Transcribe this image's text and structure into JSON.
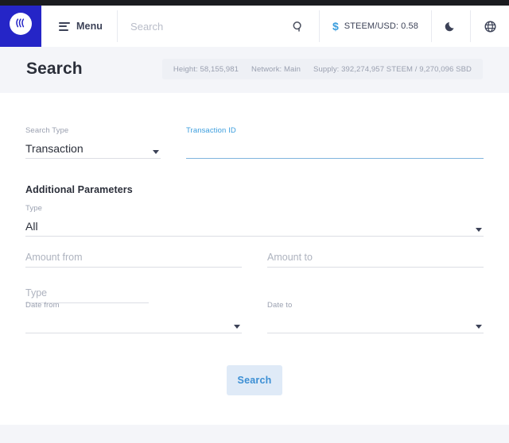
{
  "header": {
    "logo_name": "steem-logo",
    "menu_label": "Menu",
    "search_placeholder": "Search",
    "search_value": "",
    "search_icon": "magnifier-icon",
    "price_icon": "dollar-icon",
    "price_label": "STEEM/USD: 0.58",
    "dark_mode_icon": "moon-icon",
    "language_icon": "globe-icon"
  },
  "banner": {
    "title": "Search",
    "chain": {
      "height": "Height: 58,155,981",
      "network": "Network: Main",
      "supply": "Supply: 392,274,957 STEEM / 9,270,096 SBD"
    }
  },
  "form": {
    "search_type": {
      "label": "Search Type",
      "value": "Transaction"
    },
    "transaction_id": {
      "label": "Transaction ID",
      "value": ""
    },
    "additional_parameters_title": "Additional Parameters",
    "type_select": {
      "label": "Type",
      "value": "All"
    },
    "amount_from": {
      "placeholder": "Amount from",
      "value": ""
    },
    "amount_to": {
      "placeholder": "Amount to",
      "value": ""
    },
    "type_text": {
      "placeholder": "Type",
      "value": ""
    },
    "date_from": {
      "label": "Date from",
      "value": ""
    },
    "date_to": {
      "label": "Date to",
      "value": ""
    },
    "submit_label": "Search"
  },
  "colors": {
    "brand_blue": "#2525c7",
    "accent_blue": "#3c9ede",
    "button_bg": "#dfeaf7",
    "page_bg": "#f4f5f9",
    "text_dark": "#2b2f3a",
    "text_muted": "#9aa0b0"
  }
}
